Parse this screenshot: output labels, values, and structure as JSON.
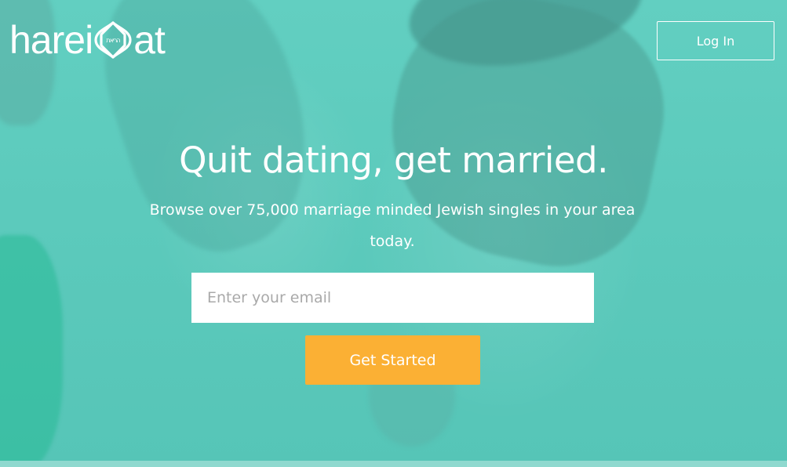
{
  "brand": {
    "name_left": "harei",
    "name_right": "at",
    "mark_label": "הריאת",
    "logo_icon": "diamond-ring-mark-icon"
  },
  "header": {
    "login_label": "Log In"
  },
  "hero": {
    "headline": "Quit dating, get married.",
    "subhead": "Browse over 75,000 marriage minded Jewish singles in your area today."
  },
  "signup": {
    "email_placeholder": "Enter your email",
    "email_value": "",
    "submit_label": "Get Started"
  },
  "colors": {
    "overlay": "#5fcbbd",
    "accent_button": "#fbb034",
    "text": "#ffffff"
  }
}
